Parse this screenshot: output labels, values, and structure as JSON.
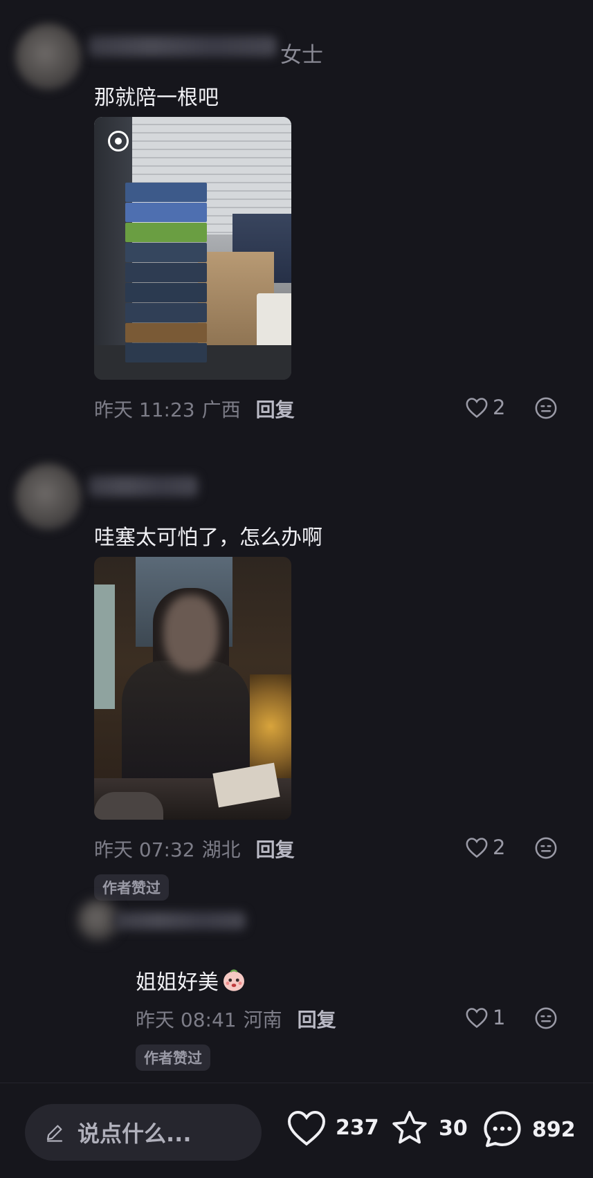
{
  "comments": [
    {
      "name_suffix": "女士",
      "text": "那就陪一根吧",
      "time": "昨天 11:23",
      "location": "广西",
      "reply_label": "回复",
      "likes": "2"
    },
    {
      "text": "哇塞太可怕了，怎么办啊",
      "time": "昨天 07:32",
      "location": "湖北",
      "reply_label": "回复",
      "likes": "2",
      "author_liked_label": "作者赞过"
    }
  ],
  "reply": {
    "text": "姐姐好美",
    "time": "昨天 08:41",
    "location": "河南",
    "reply_label": "回复",
    "likes": "1",
    "author_liked_label": "作者赞过"
  },
  "bottom_bar": {
    "input_placeholder": "说点什么...",
    "like_count": "237",
    "star_count": "30",
    "comment_count": "892"
  }
}
